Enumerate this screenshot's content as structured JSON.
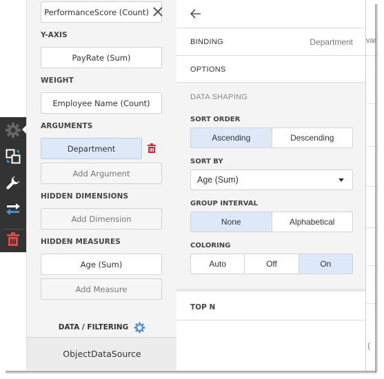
{
  "background": {
    "right_text": "var",
    "right_paren": "("
  },
  "toolbar": {
    "items": [
      {
        "icon": "gear-icon",
        "color": "#666666"
      },
      {
        "icon": "convert-icon",
        "color": "#4a90d9"
      },
      {
        "icon": "wrench-icon",
        "color": "#ffffff"
      },
      {
        "icon": "interactivity-icon",
        "color": "#4a90d9"
      },
      {
        "icon": "trash-icon",
        "color": "#e04848"
      }
    ]
  },
  "left_panel": {
    "top_field": "PerformanceScore (Count)",
    "y_axis": {
      "label": "Y-AXIS",
      "value": "PayRate (Sum)"
    },
    "weight": {
      "label": "WEIGHT",
      "value": "Employee Name (Count)"
    },
    "arguments": {
      "label": "ARGUMENTS",
      "value": "Department",
      "add_label": "Add Argument"
    },
    "hidden_dimensions": {
      "label": "HIDDEN DIMENSIONS",
      "add_label": "Add Dimension"
    },
    "hidden_measures": {
      "label": "HIDDEN MEASURES",
      "value": "Age (Sum)",
      "add_label": "Add Measure"
    },
    "data_filtering": "DATA / FILTERING",
    "datasource": "ObjectDataSource"
  },
  "right_panel": {
    "binding": {
      "label": "BINDING",
      "value": "Department"
    },
    "options": {
      "label": "OPTIONS"
    },
    "data_shaping": {
      "title": "DATA SHAPING",
      "sort_order": {
        "label": "SORT ORDER",
        "options": [
          "Ascending",
          "Descending"
        ],
        "selected": "Ascending"
      },
      "sort_by": {
        "label": "SORT BY",
        "value": "Age (Sum)"
      },
      "group_interval": {
        "label": "GROUP INTERVAL",
        "options": [
          "None",
          "Alphabetical"
        ],
        "selected": "None"
      },
      "coloring": {
        "label": "COLORING",
        "options": [
          "Auto",
          "Off",
          "On"
        ],
        "selected": "On"
      }
    },
    "top_n": {
      "label": "TOP N"
    }
  },
  "colors": {
    "accent": "#4a90d9",
    "selected_bg": "#dde9f9",
    "danger": "#d0253a",
    "toolbar_bg": "#333333"
  }
}
